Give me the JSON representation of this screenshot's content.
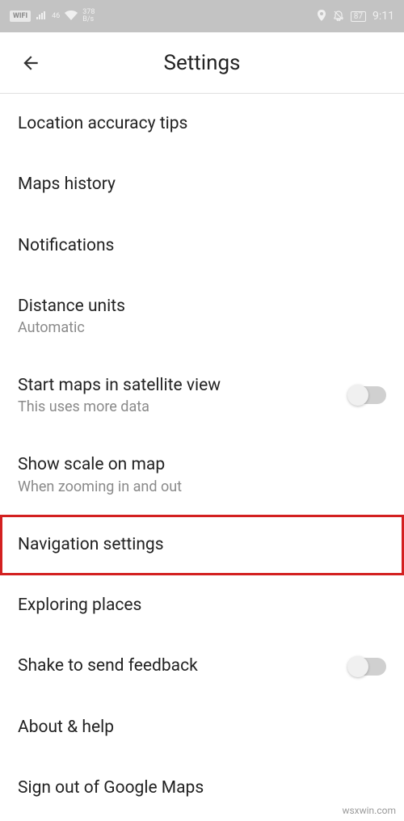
{
  "status_bar": {
    "wifi_label": "WIFI",
    "signal_text": "46",
    "net_top": "378",
    "net_bottom": "B/s",
    "battery": "87",
    "time": "9:11"
  },
  "header": {
    "title": "Settings"
  },
  "items": [
    {
      "title": "Location accuracy tips",
      "sub": "",
      "toggle": false,
      "highlighted": false
    },
    {
      "title": "Maps history",
      "sub": "",
      "toggle": false,
      "highlighted": false
    },
    {
      "title": "Notifications",
      "sub": "",
      "toggle": false,
      "highlighted": false
    },
    {
      "title": "Distance units",
      "sub": "Automatic",
      "toggle": false,
      "highlighted": false
    },
    {
      "title": "Start maps in satellite view",
      "sub": "This uses more data",
      "toggle": true,
      "highlighted": false
    },
    {
      "title": "Show scale on map",
      "sub": "When zooming in and out",
      "toggle": false,
      "highlighted": false
    },
    {
      "title": "Navigation settings",
      "sub": "",
      "toggle": false,
      "highlighted": true
    },
    {
      "title": "Exploring places",
      "sub": "",
      "toggle": false,
      "highlighted": false
    },
    {
      "title": "Shake to send feedback",
      "sub": "",
      "toggle": true,
      "highlighted": false
    },
    {
      "title": "About & help",
      "sub": "",
      "toggle": false,
      "highlighted": false
    },
    {
      "title": "Sign out of Google Maps",
      "sub": "",
      "toggle": false,
      "highlighted": false
    }
  ],
  "watermark": "wsxwin.com"
}
